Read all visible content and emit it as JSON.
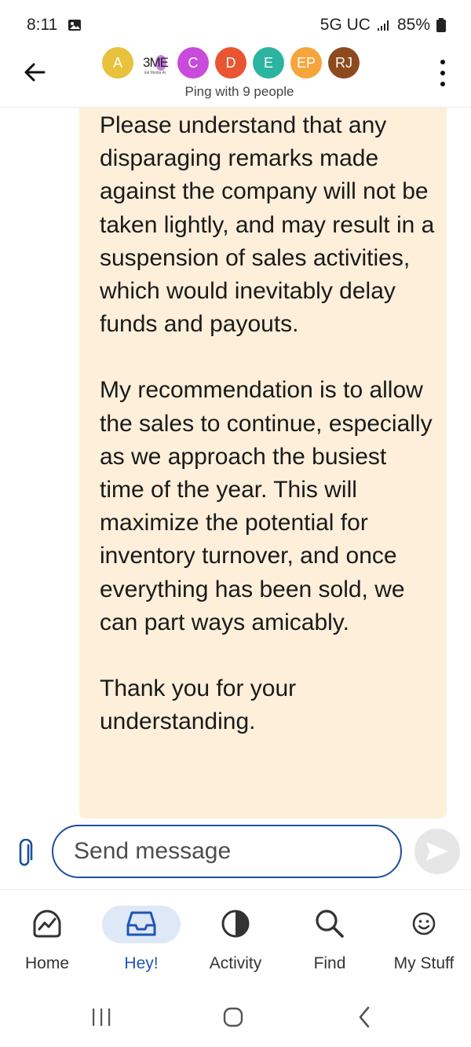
{
  "status_bar": {
    "time": "8:11",
    "network": "5G UC",
    "battery": "85%"
  },
  "header": {
    "avatars": [
      {
        "label": "A",
        "color": "#e8c23c"
      },
      {
        "label": "3ME",
        "sub": "ital Media Ar",
        "color": "#ffffff"
      },
      {
        "label": "C",
        "color": "#c94bdc"
      },
      {
        "label": "D",
        "color": "#e95533"
      },
      {
        "label": "E",
        "color": "#2bb5a0"
      },
      {
        "label": "EP",
        "color": "#f6a53c"
      },
      {
        "label": "RJ",
        "color": "#8d4a1e"
      }
    ],
    "subtitle": "Ping with 9 people"
  },
  "message": {
    "paragraphs": [
      "Please understand that any disparaging remarks made against the company will not be taken lightly, and may result in a suspension of sales activities, which would inevitably delay funds and payouts.",
      "My recommendation is to allow the sales to continue, especially as we approach the busiest time of the year. This will maximize the potential for inventory turnover, and once everything has been sold, we can part ways amicably.",
      "Thank you for your understanding."
    ],
    "bubble_color": "#fdefd9"
  },
  "composer": {
    "placeholder": "Send message"
  },
  "bottom_nav": [
    {
      "label": "Home",
      "icon": "home-icon"
    },
    {
      "label": "Hey!",
      "icon": "inbox-icon",
      "active": true
    },
    {
      "label": "Activity",
      "icon": "activity-icon"
    },
    {
      "label": "Find",
      "icon": "search-icon"
    },
    {
      "label": "My Stuff",
      "icon": "smiley-icon"
    }
  ],
  "colors": {
    "accent": "#1f56b6",
    "input_border": "#1d4f9c"
  }
}
